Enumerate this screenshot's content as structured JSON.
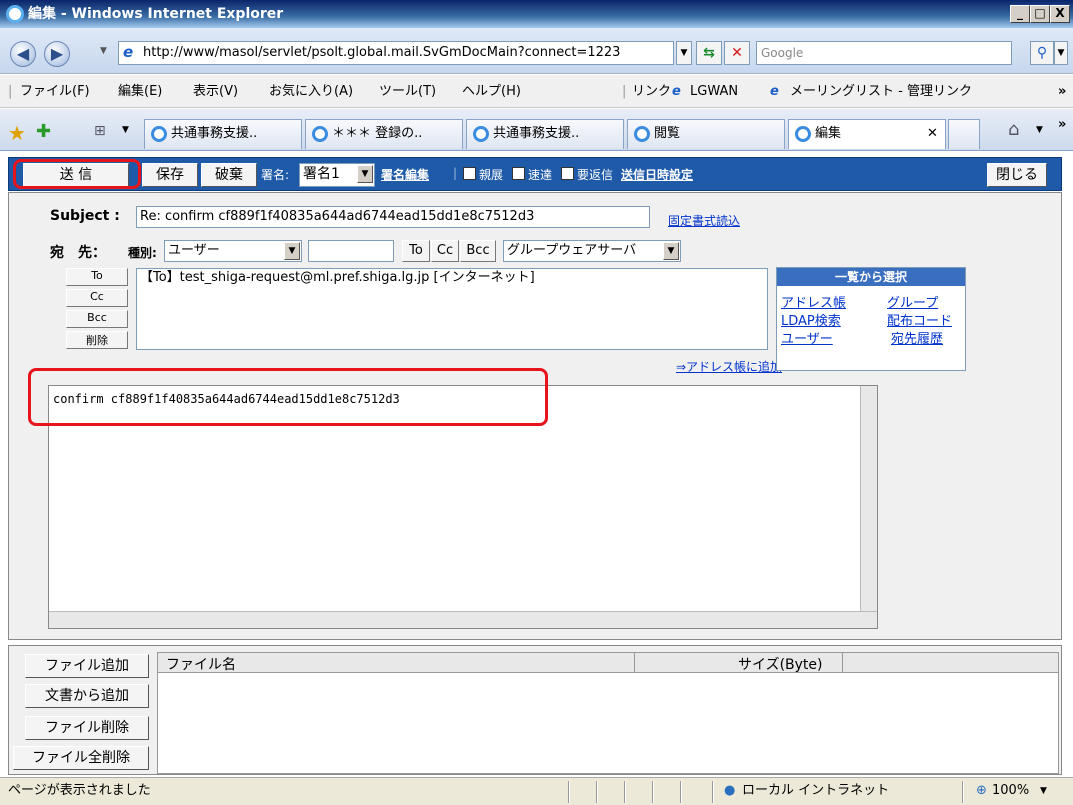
{
  "window": {
    "title": "編集 - Windows Internet Explorer",
    "min": "_",
    "max": "□",
    "close": "X"
  },
  "address": {
    "url": "http://www/masol/servlet/psolt.global.mail.SvGmDocMain?connect=1223",
    "search_placeholder": "Google"
  },
  "menu": {
    "items": [
      "ファイル(F)",
      "編集(E)",
      "表示(V)",
      "お気に入り(A)",
      "ツール(T)",
      "ヘルプ(H)"
    ],
    "links_label": "リンク",
    "link1": "LGWAN",
    "link2": "メーリングリスト - 管理リンク"
  },
  "tabs": [
    "共通事務支援..",
    "＊＊＊ 登録の..",
    "共通事務支援..",
    "閲覧",
    "編集"
  ],
  "toolbar": {
    "send": "送 信",
    "save": "保存",
    "discard": "破棄",
    "signature_label": "署名:",
    "signature_value": "署名1",
    "signature_edit": "署名編集",
    "check1": "親展",
    "check2": "速達",
    "check3": "要返信",
    "schedule": "送信日時設定",
    "close": "閉じる"
  },
  "compose": {
    "subject_label": "Subject :",
    "subject_value": "Re: confirm cf889f1f40835a644ad6744ead15dd1e8c7512d3",
    "fixed_format": "固定書式読込",
    "to_label": "宛　先：",
    "kind_label": "種別:",
    "kind_value": "ユーザー",
    "btn_to": "To",
    "btn_cc": "Cc",
    "btn_bcc": "Bcc",
    "server_value": "グループウェアサーバ",
    "side_to": "To",
    "side_cc": "Cc",
    "side_bcc": "Bcc",
    "side_delete": "削除",
    "recipient": "【To】test_shiga-request@ml.pref.shiga.lg.jp [インターネット]",
    "add_to_address": "⇒アドレス帳に追加",
    "body": "confirm cf889f1f40835a644ad6744ead15dd1e8c7512d3"
  },
  "select_panel": {
    "title": "一覧から選択",
    "address_book": "アドレス帳",
    "group": "グループ",
    "ldap": "LDAP検索",
    "dist_code": "配布コード",
    "user": "ユーザー",
    "history": "宛先履歴"
  },
  "attachments": {
    "add_file": "ファイル追加",
    "add_from_doc": "文書から追加",
    "delete_file": "ファイル削除",
    "delete_all": "ファイル全削除",
    "col_name": "ファイル名",
    "col_size": "サイズ(Byte)"
  },
  "status": {
    "text": "ページが表示されました",
    "zone": "ローカル イントラネット",
    "zoom": "100%"
  }
}
